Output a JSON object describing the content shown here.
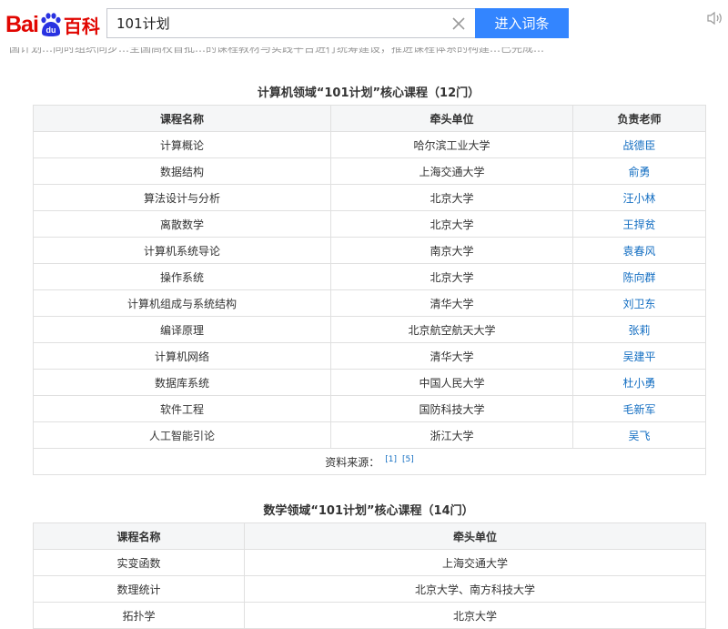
{
  "header": {
    "logo_left": "Bai",
    "logo_mid": "du",
    "logo_right": "百科",
    "search_value": "101计划",
    "submit_label": "进入词条"
  },
  "intro_fragment": "国计划…同时组织同步…全国高校首批…的课程教材与实践平台进行统筹建设，推进课程体系的构建…已完成…",
  "cs_section": {
    "title": "计算机领域“101计划”核心课程（12门）",
    "headers": [
      "课程名称",
      "牵头单位",
      "负责老师"
    ],
    "rows": [
      [
        "计算概论",
        "哈尔滨工业大学",
        "战德臣"
      ],
      [
        "数据结构",
        "上海交通大学",
        "俞勇"
      ],
      [
        "算法设计与分析",
        "北京大学",
        "汪小林"
      ],
      [
        "离散数学",
        "北京大学",
        "王捍贫"
      ],
      [
        "计算机系统导论",
        "南京大学",
        "袁春风"
      ],
      [
        "操作系统",
        "北京大学",
        "陈向群"
      ],
      [
        "计算机组成与系统结构",
        "清华大学",
        "刘卫东"
      ],
      [
        "编译原理",
        "北京航空航天大学",
        "张莉"
      ],
      [
        "计算机网络",
        "清华大学",
        "吴建平"
      ],
      [
        "数据库系统",
        "中国人民大学",
        "杜小勇"
      ],
      [
        "软件工程",
        "国防科技大学",
        "毛新军"
      ],
      [
        "人工智能引论",
        "浙江大学",
        "吴飞"
      ]
    ],
    "source_label": "资料来源：",
    "refs": [
      "[1]",
      "[5]"
    ]
  },
  "math_section": {
    "title": "数学领域“101计划”核心课程（14门）",
    "headers": [
      "课程名称",
      "牵头单位"
    ],
    "rows": [
      [
        "实变函数",
        "上海交通大学"
      ],
      [
        "数理统计",
        "北京大学、南方科技大学"
      ],
      [
        "拓扑学",
        "北京大学"
      ]
    ]
  },
  "colors": {
    "brand_red": "#e10601",
    "brand_blue": "#2932e1",
    "button_blue": "#3385ff",
    "link_blue": "#136ec2"
  },
  "icons": [
    "close-icon",
    "sound-icon",
    "baidu-paw-logo"
  ]
}
